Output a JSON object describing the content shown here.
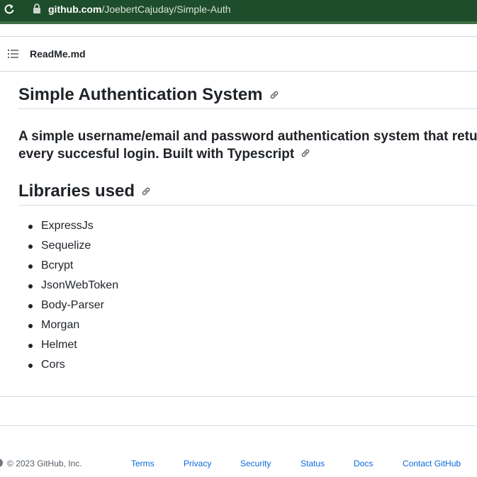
{
  "browser": {
    "url_host": "github.com",
    "url_path": "/JoebertCajuday/Simple-Auth"
  },
  "file_header": {
    "file_name": "ReadMe.md"
  },
  "readme": {
    "title": "Simple Authentication System",
    "description_line1": "A simple username/email and password authentication system that retu",
    "description_line2": "every succesful login. Built with Typescript",
    "libraries_heading": "Libraries used",
    "libraries": [
      "ExpressJs",
      "Sequelize",
      "Bcrypt",
      "JsonWebToken",
      "Body-Parser",
      "Morgan",
      "Helmet",
      "Cors"
    ]
  },
  "footer": {
    "copyright": "© 2023 GitHub, Inc.",
    "links": [
      "Terms",
      "Privacy",
      "Security",
      "Status",
      "Docs",
      "Contact GitHub"
    ]
  },
  "colors": {
    "browser_bar": "#1e4d2b",
    "link": "#0969da",
    "text": "#1f2328",
    "muted": "#57606a"
  },
  "icons": [
    "reload-icon",
    "lock-icon",
    "table-of-contents-icon",
    "link-icon",
    "github-mark-icon"
  ]
}
